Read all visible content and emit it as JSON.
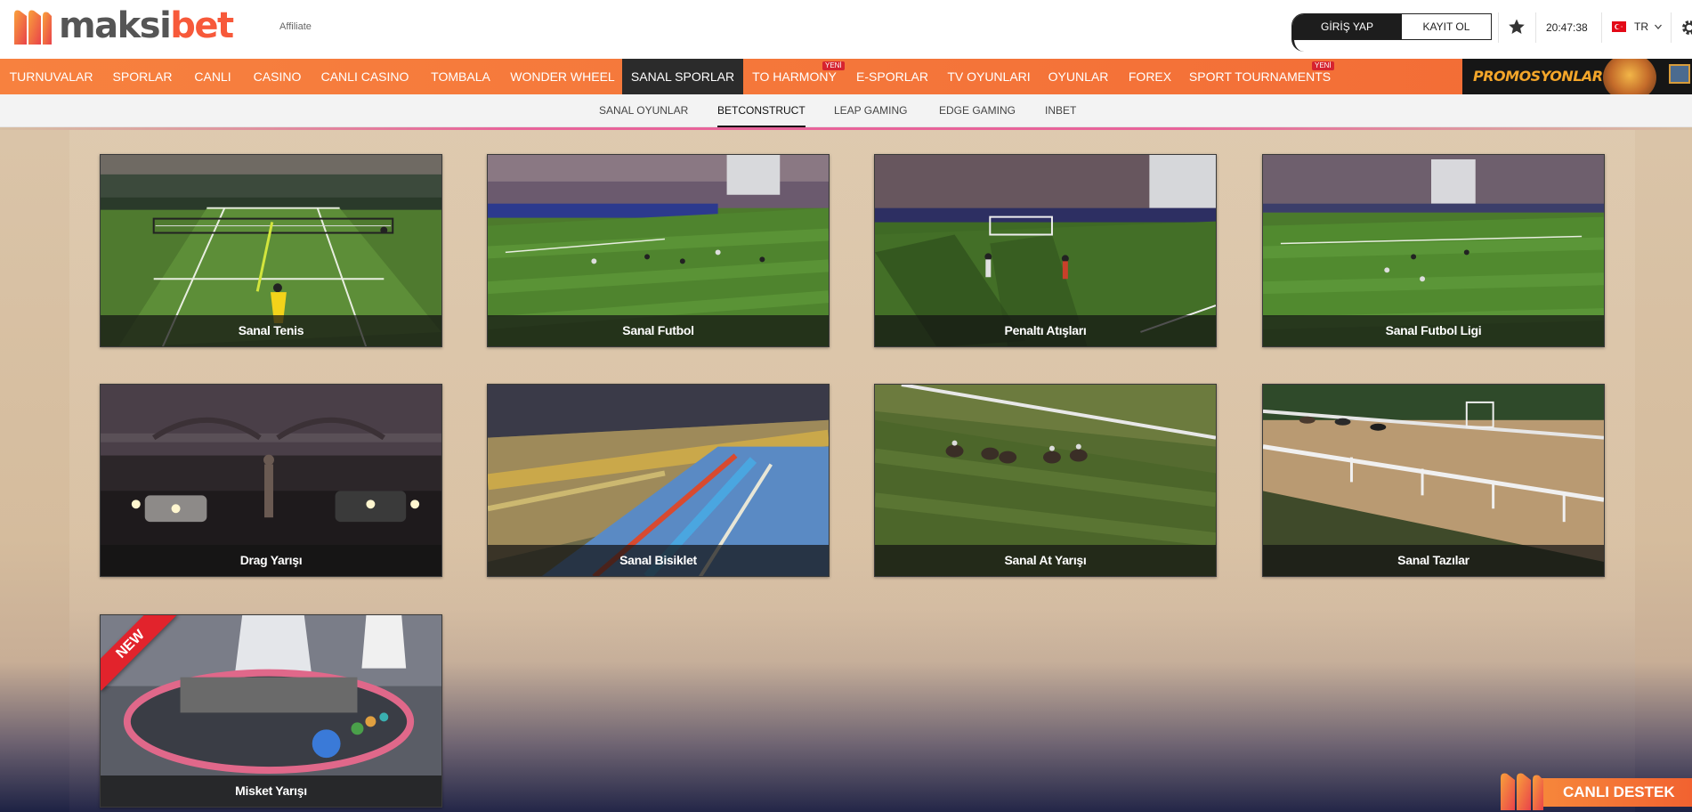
{
  "brand": {
    "name_part1": "maksi",
    "name_part2": "bet",
    "affiliate": "Affiliate"
  },
  "header": {
    "login": "GİRİŞ YAP",
    "register": "KAYIT OL",
    "time": "20:47:38",
    "language": "TR",
    "icons": [
      "star-icon",
      "turkey-flag-icon",
      "chevron-down-icon",
      "gear-icon"
    ]
  },
  "mainnav": {
    "items": [
      {
        "label": "TURNUVALAR"
      },
      {
        "label": "SPORLAR"
      },
      {
        "label": "CANLI"
      },
      {
        "label": "CASINO"
      },
      {
        "label": "CANLI CASINO"
      },
      {
        "label": "TOMBALA"
      },
      {
        "label": "WONDER WHEEL"
      },
      {
        "label": "SANAL SPORLAR",
        "active": true
      },
      {
        "label": "TO HARMONY",
        "badge": "YENİ"
      },
      {
        "label": "E-SPORLAR"
      },
      {
        "label": "TV OYUNLARI"
      },
      {
        "label": "OYUNLAR"
      },
      {
        "label": "FOREX"
      },
      {
        "label": "SPORT TOURNAMENTS",
        "badge": "YENİ"
      }
    ],
    "promo": "PROMOSYONLAR"
  },
  "subnav": {
    "items": [
      {
        "label": "SANAL OYUNLAR"
      },
      {
        "label": "BETCONSTRUCT",
        "active": true
      },
      {
        "label": "LEAP GAMING"
      },
      {
        "label": "EDGE GAMING"
      },
      {
        "label": "INBET"
      }
    ]
  },
  "games": [
    {
      "title": "Sanal Tenis"
    },
    {
      "title": "Sanal Futbol"
    },
    {
      "title": "Penaltı Atışları"
    },
    {
      "title": "Sanal Futbol Ligi"
    },
    {
      "title": "Drag Yarışı"
    },
    {
      "title": "Sanal Bisiklet"
    },
    {
      "title": "Sanal At Yarışı"
    },
    {
      "title": "Sanal Tazılar"
    },
    {
      "title": "Misket Yarışı",
      "ribbon": "NEW"
    }
  ],
  "support": {
    "label": "CANLI DESTEK"
  },
  "colors": {
    "accent": "#f26b35",
    "nav_active": "#2b2b2b",
    "new_badge": "#d6232f"
  }
}
